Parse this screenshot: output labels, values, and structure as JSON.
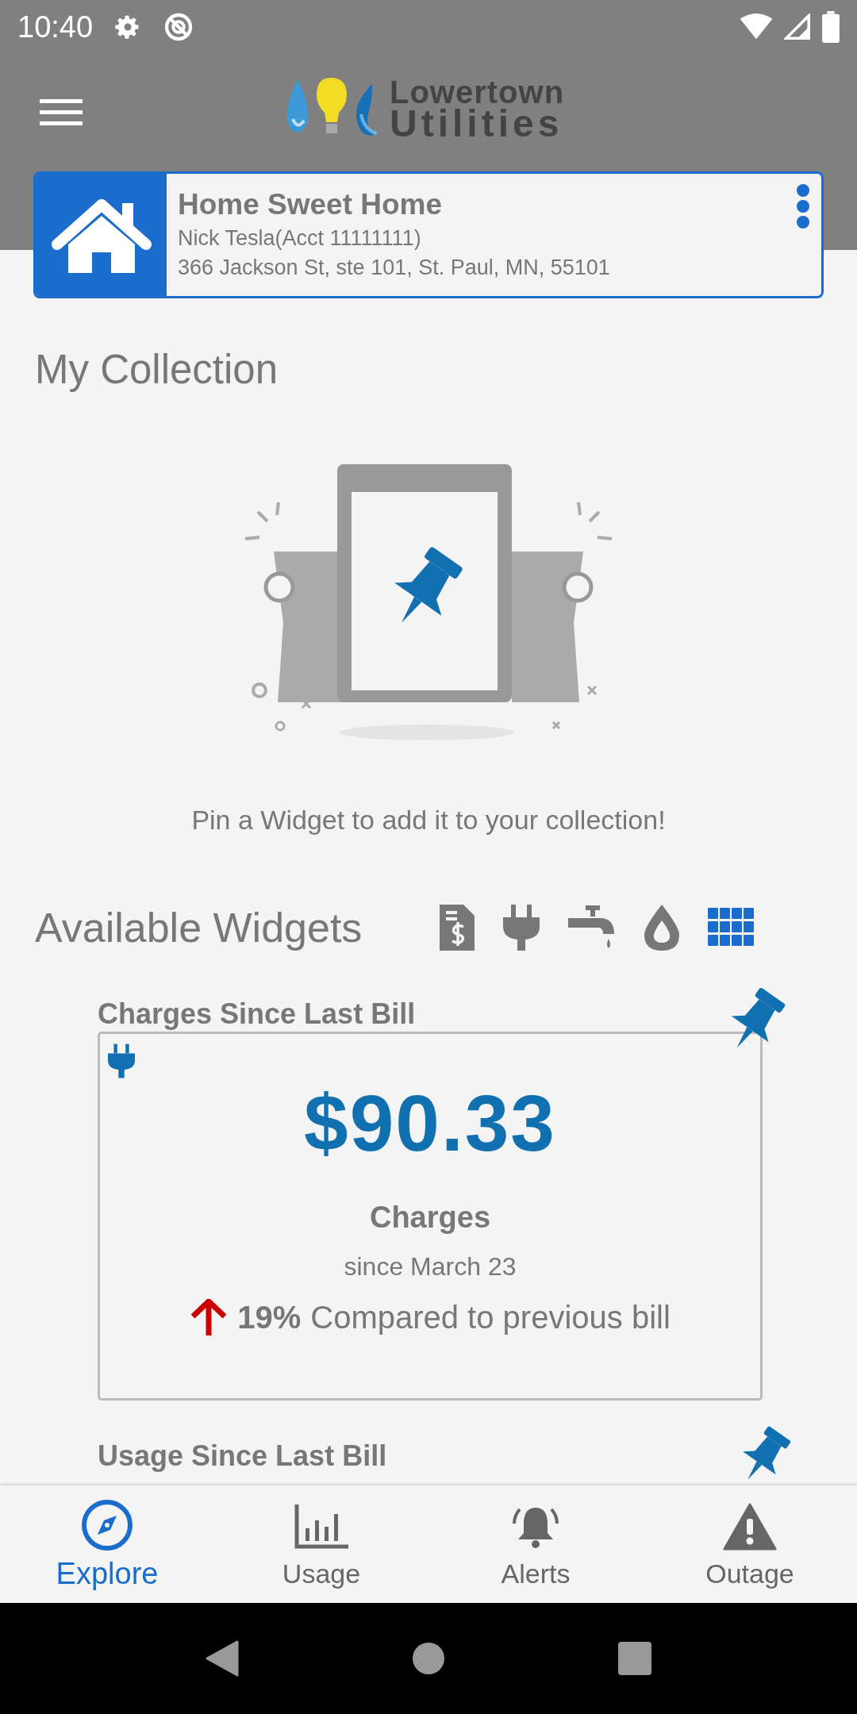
{
  "status_bar": {
    "time": "10:40"
  },
  "header": {
    "logo_top": "Lowertown",
    "logo_bottom": "Utilities"
  },
  "account": {
    "name": "Home Sweet Home",
    "holder": "Nick Tesla(Acct 11111111)",
    "address": "366 Jackson St, ste 101, St. Paul, MN, 55101"
  },
  "collection": {
    "title": "My Collection",
    "empty_message": "Pin a Widget to add it to your collection!"
  },
  "available": {
    "title": "Available Widgets",
    "filters": [
      {
        "selected": false
      },
      {
        "selected": false
      },
      {
        "selected": false
      },
      {
        "selected": false
      },
      {
        "selected": true
      }
    ]
  },
  "widgets": [
    {
      "title": "Charges Since Last Bill",
      "amount": "$90.33",
      "label": "Charges",
      "since": "since March 23",
      "increased": true,
      "change": "19%",
      "comparison": "Compared to previous bill"
    },
    {
      "title": "Usage Since Last Bill"
    }
  ],
  "tabs": [
    {
      "label": "Explore",
      "selected": true
    },
    {
      "label": "Usage",
      "selected": false
    },
    {
      "label": "Alerts",
      "selected": false
    },
    {
      "label": "Outage",
      "selected": false
    }
  ]
}
